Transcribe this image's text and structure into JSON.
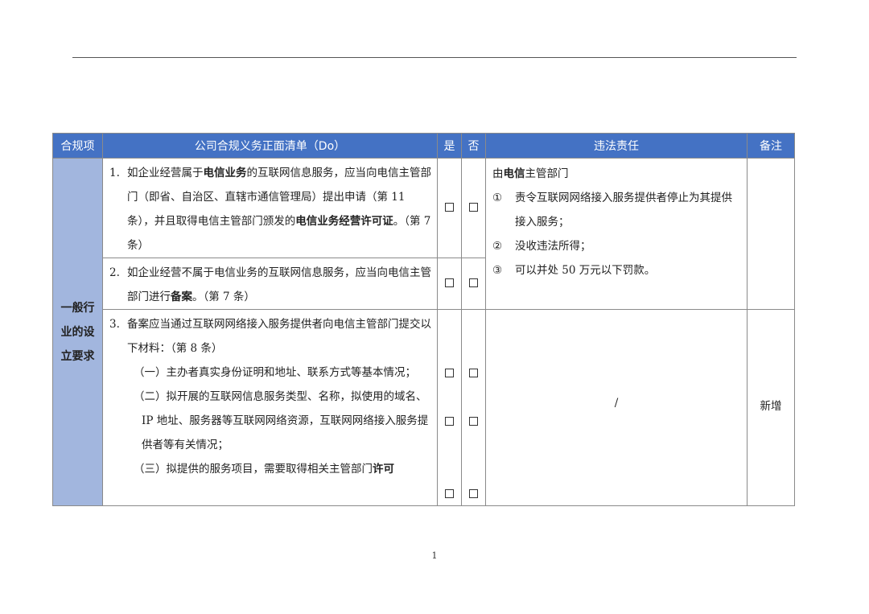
{
  "header": {
    "category": "合规项",
    "do_list": "公司合规义务正面清单（Do）",
    "yes": "是",
    "no": "否",
    "liability": "违法责任",
    "notes": "备注"
  },
  "category_label": "一般行业的设立要求",
  "items": {
    "item1": {
      "num": "1.",
      "pre1": "如企业经营属于",
      "b1": "电信业务",
      "mid1": "的互联网信息服务，应当向电信主管部门（即省、自治区、直辖市通信管理局）提出申请（第 11 条），并且取得电信主管部门颁发的",
      "b2": "电信业务经营许可证",
      "post1": "。（第 7 条）"
    },
    "item2": {
      "num": "2.",
      "pre": "如企业经营不属于电信业务的互联网信息服务，应当向电信主管部门进行",
      "b": "备案",
      "post": "。（第 7 条）"
    },
    "item3": {
      "num": "3.",
      "intro": "备案应当通过互联网网络接入服务提供者向电信主管部门提交以下材料：（第 8 条）",
      "sub1": "（一）主办者真实身份证明和地址、联系方式等基本情况；",
      "sub2": "（二）拟开展的互联网信息服务类型、名称，拟使用的域名、IP 地址、服务器等互联网网络资源，互联网网络接入服务提供者等有关情况；",
      "sub3_pre": "（三）拟提供的服务项目，需要取得相关主管部门",
      "sub3_b": "许可"
    }
  },
  "liability": {
    "lead_pre": "由",
    "lead_b": "电信",
    "lead_post": "主管部门",
    "p1_mark": "①",
    "p1": "责令互联网网络接入服务提供者停止为其提供接入服务；",
    "p2_mark": "②",
    "p2": "没收违法所得；",
    "p3_mark": "③",
    "p3": "可以并处 50 万元以下罚款。",
    "slash": "/"
  },
  "notes": {
    "item3": "新增"
  },
  "page_number": "1"
}
